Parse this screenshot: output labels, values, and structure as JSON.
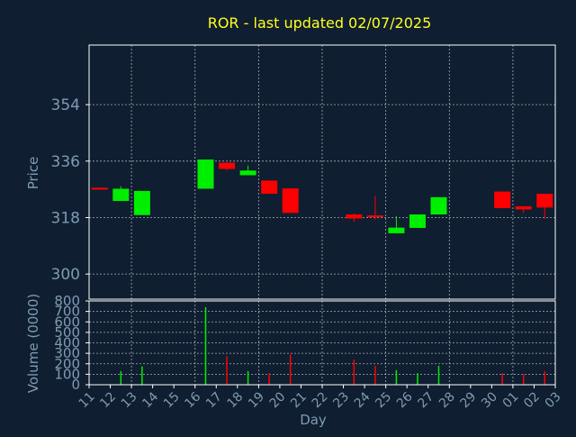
{
  "chart_data": {
    "type": "candlestick",
    "title": "ROR - last updated 02/07/2025",
    "price_axis": {
      "label": "Price",
      "ticks": [
        300,
        318,
        336,
        354
      ],
      "ylim": [
        292,
        373
      ]
    },
    "volume_axis": {
      "label": "Volume (0000)",
      "ticks": [
        0,
        100,
        200,
        300,
        400,
        500,
        600,
        700,
        800
      ],
      "ylim": [
        0,
        800
      ]
    },
    "x_axis": {
      "label": "Day",
      "ticks": [
        "11",
        "12",
        "13",
        "14",
        "15",
        "16",
        "17",
        "18",
        "19",
        "20",
        "21",
        "22",
        "23",
        "24",
        "25",
        "26",
        "27",
        "28",
        "29",
        "30",
        "01",
        "02",
        "03"
      ]
    },
    "up_color": "#00ee00",
    "down_color": "#ff0000",
    "candles": [
      {
        "x": "11",
        "open": 327.5,
        "close": 327.2,
        "high": 327.6,
        "low": 327.0,
        "volume": 0
      },
      {
        "x": "12",
        "open": 323.3,
        "close": 327.2,
        "high": 328.0,
        "low": 323.3,
        "volume": 130
      },
      {
        "x": "13",
        "open": 318.8,
        "close": 326.5,
        "high": 326.5,
        "low": 318.8,
        "volume": 175
      },
      {
        "x": "16",
        "open": 327.2,
        "close": 336.5,
        "high": 336.5,
        "low": 327.2,
        "volume": 740
      },
      {
        "x": "17",
        "open": 335.5,
        "close": 333.5,
        "high": 335.5,
        "low": 333.0,
        "volume": 270
      },
      {
        "x": "18",
        "open": 331.5,
        "close": 333.0,
        "high": 334.6,
        "low": 331.5,
        "volume": 130
      },
      {
        "x": "19",
        "open": 329.8,
        "close": 325.6,
        "high": 329.8,
        "low": 325.6,
        "volume": 110
      },
      {
        "x": "20",
        "open": 327.3,
        "close": 319.5,
        "high": 327.3,
        "low": 319.5,
        "volume": 290
      },
      {
        "x": "23",
        "open": 319.0,
        "close": 317.7,
        "high": 319.3,
        "low": 316.6,
        "volume": 240
      },
      {
        "x": "24",
        "open": 318.7,
        "close": 318.3,
        "high": 325.0,
        "low": 317.4,
        "volume": 180
      },
      {
        "x": "25",
        "open": 313.0,
        "close": 314.8,
        "high": 318.5,
        "low": 313.0,
        "volume": 140
      },
      {
        "x": "26",
        "open": 314.7,
        "close": 319.0,
        "high": 319.0,
        "low": 314.7,
        "volume": 110
      },
      {
        "x": "27",
        "open": 319.0,
        "close": 324.5,
        "high": 324.5,
        "low": 319.0,
        "volume": 180
      },
      {
        "x": "30",
        "open": 326.3,
        "close": 321.0,
        "high": 326.3,
        "low": 321.0,
        "volume": 110
      },
      {
        "x": "01",
        "open": 321.6,
        "close": 320.6,
        "high": 321.6,
        "low": 319.5,
        "volume": 100
      },
      {
        "x": "02",
        "open": 325.6,
        "close": 321.2,
        "high": 325.6,
        "low": 317.6,
        "volume": 130
      }
    ]
  }
}
